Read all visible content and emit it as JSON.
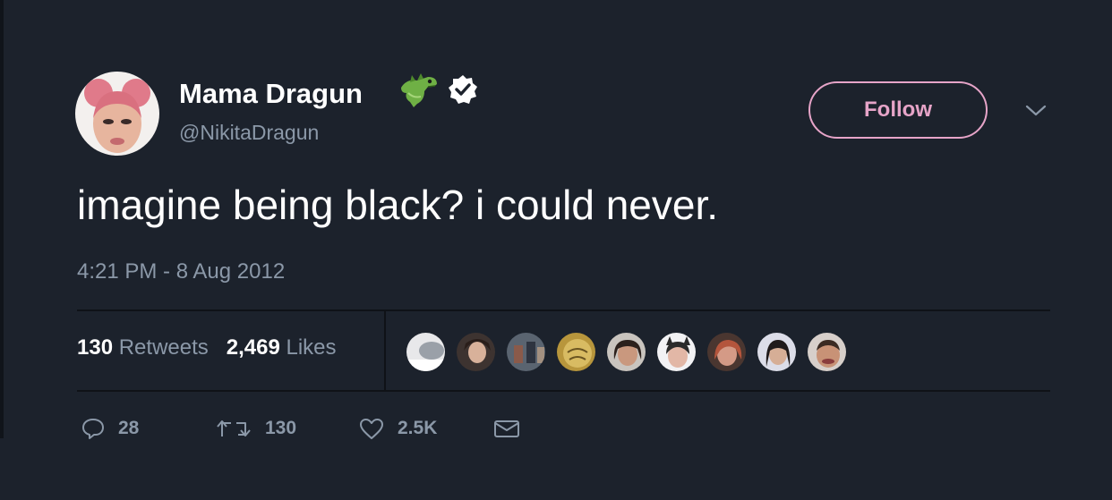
{
  "tweet": {
    "display_name": "Mama Dragun",
    "handle": "@NikitaDragun",
    "follow_label": "Follow",
    "text": "imagine being black? i could never.",
    "timestamp": "4:21 PM - 8 Aug 2012",
    "retweets_count": "130",
    "retweets_label": "Retweets",
    "likes_count": "2,469",
    "likes_label": "Likes",
    "liker_avatar_count": 9
  },
  "actions": {
    "reply_count": "28",
    "retweet_count": "130",
    "like_count": "2.5K"
  },
  "icons": {
    "name_emoji": "dragon-emoji",
    "verified": "verified-badge",
    "caret": "chevron-down-icon",
    "reply": "reply-icon",
    "retweet": "retweet-icon",
    "like": "heart-icon",
    "dm": "envelope-icon"
  },
  "colors": {
    "background": "#1c222c",
    "text_primary": "#ffffff",
    "text_secondary": "#8b98a8",
    "follow_accent": "#e6a4c8",
    "dragon_green": "#6fb045"
  }
}
